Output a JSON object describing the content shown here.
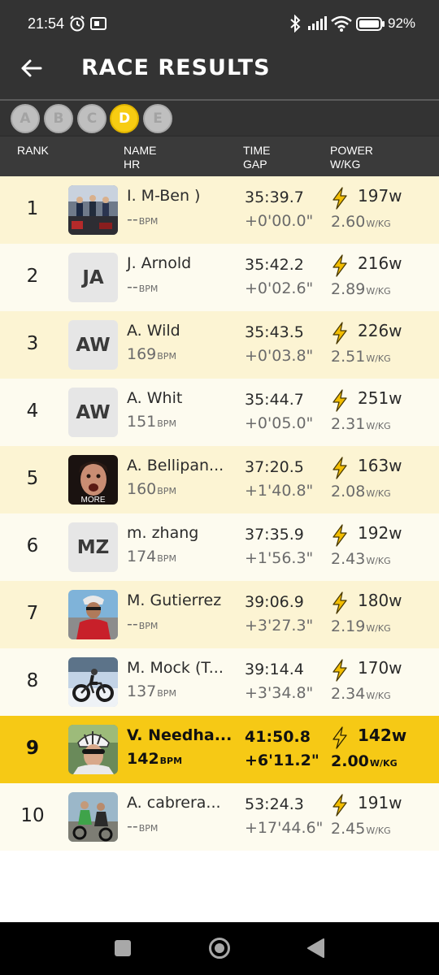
{
  "status_bar": {
    "time": "21:54",
    "battery": "92%"
  },
  "header": {
    "title": "RACE RESULTS"
  },
  "categories": [
    {
      "label": "A",
      "active": false
    },
    {
      "label": "B",
      "active": false
    },
    {
      "label": "C",
      "active": false
    },
    {
      "label": "D",
      "active": true
    },
    {
      "label": "E",
      "active": false
    }
  ],
  "columns": {
    "rank": "RANK",
    "name": "NAME",
    "hr": "HR",
    "time": "TIME",
    "gap": "GAP",
    "power": "POWER",
    "wkg": "W/KG"
  },
  "units": {
    "bpm": "BPM",
    "wkg": "W/KG"
  },
  "more_label": "MORE",
  "colors": {
    "highlight": "#f6c915",
    "row_odd": "#fcf4d3",
    "row_even": "#fdfbef",
    "bolt": "#f0b800",
    "header_bg": "#333333"
  },
  "results": [
    {
      "rank": "1",
      "avatar": "photo-group",
      "name": "I. M-Ben )",
      "hr": "--",
      "time": "35:39.7",
      "gap": "+0'00.0\"",
      "watts": "197w",
      "wkg": "2.60"
    },
    {
      "rank": "2",
      "avatar": "initials",
      "initials": "JA",
      "name": "J. Arnold",
      "hr": "--",
      "time": "35:42.2",
      "gap": "+0'02.6\"",
      "watts": "216w",
      "wkg": "2.89"
    },
    {
      "rank": "3",
      "avatar": "initials",
      "initials": "AW",
      "name": "A. Wild",
      "hr": "169",
      "time": "35:43.5",
      "gap": "+0'03.8\"",
      "watts": "226w",
      "wkg": "2.51"
    },
    {
      "rank": "4",
      "avatar": "initials",
      "initials": "AW",
      "name": "A. Whit",
      "hr": "151",
      "time": "35:44.7",
      "gap": "+0'05.0\"",
      "watts": "251w",
      "wkg": "2.31"
    },
    {
      "rank": "5",
      "avatar": "photo-face",
      "name": "A. Bellipan...",
      "hr": "160",
      "time": "37:20.5",
      "gap": "+1'40.8\"",
      "watts": "163w",
      "wkg": "2.08"
    },
    {
      "rank": "6",
      "avatar": "initials",
      "initials": "MZ",
      "name": "m. zhang",
      "hr": "174",
      "time": "37:35.9",
      "gap": "+1'56.3\"",
      "watts": "192w",
      "wkg": "2.43"
    },
    {
      "rank": "7",
      "avatar": "photo-cyclist-red",
      "name": "M. Gutierrez",
      "hr": "--",
      "time": "39:06.9",
      "gap": "+3'27.3\"",
      "watts": "180w",
      "wkg": "2.19"
    },
    {
      "rank": "8",
      "avatar": "photo-snow-bike",
      "name": "M. Mock (T...",
      "hr": "137",
      "time": "39:14.4",
      "gap": "+3'34.8\"",
      "watts": "170w",
      "wkg": "2.34"
    },
    {
      "rank": "9",
      "avatar": "photo-helmet",
      "name": "V. Needha...",
      "hr": "142",
      "time": "41:50.8",
      "gap": "+6'11.2\"",
      "watts": "142w",
      "wkg": "2.00",
      "highlight": true
    },
    {
      "rank": "10",
      "avatar": "photo-cyclist-green",
      "name": "A. cabrera...",
      "hr": "--",
      "time": "53:24.3",
      "gap": "+17'44.6\"",
      "watts": "191w",
      "wkg": "2.45"
    }
  ]
}
